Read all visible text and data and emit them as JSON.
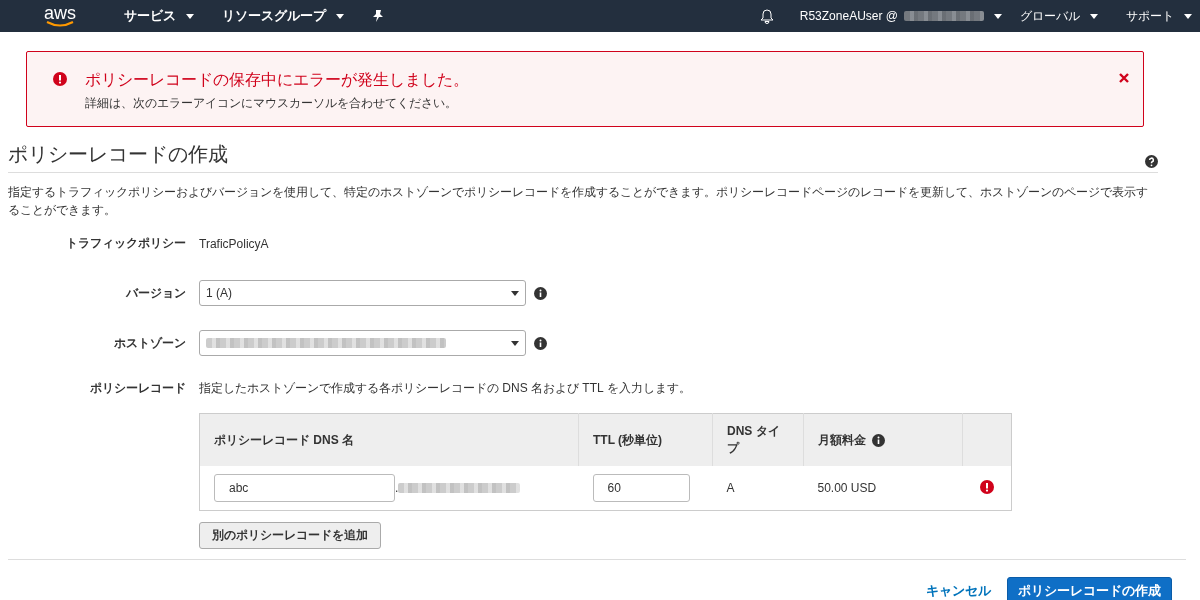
{
  "navbar": {
    "logo": "aws",
    "menus": [
      {
        "label": "サービス"
      },
      {
        "label": "リソースグループ"
      }
    ],
    "user": "R53ZoneAUser @",
    "region": "グローバル",
    "support": "サポート"
  },
  "alert": {
    "title": "ポリシーレコードの保存中にエラーが発生しました。",
    "message": "詳細は、次のエラーアイコンにマウスカーソルを合わせてください。"
  },
  "page": {
    "title": "ポリシーレコードの作成",
    "description": "指定するトラフィックポリシーおよびバージョンを使用して、特定のホストゾーンでポリシーレコードを作成することができます。ポリシーレコードページのレコードを更新して、ホストゾーンのページで表示することができます。"
  },
  "form": {
    "traffic_policy": {
      "label": "トラフィックポリシー",
      "value": "TraficPolicyA"
    },
    "version": {
      "label": "バージョン",
      "value": "1 (A)"
    },
    "hosted_zone": {
      "label": "ホストゾーン"
    },
    "policy_record": {
      "label": "ポリシーレコード",
      "hint": "指定したホストゾーンで作成する各ポリシーレコードの DNS 名および TTL を入力します。"
    }
  },
  "table": {
    "columns": [
      "ポリシーレコード DNS 名",
      "TTL (秒単位)",
      "DNS タイプ",
      "月額料金"
    ],
    "rows": [
      {
        "dns_name": "abc",
        "separator": ".",
        "ttl": "60",
        "type": "A",
        "price": "50.00 USD",
        "error": true
      }
    ]
  },
  "add_button": "別のポリシーレコードを追加",
  "footer": {
    "cancel": "キャンセル",
    "submit": "ポリシーレコードの作成"
  }
}
